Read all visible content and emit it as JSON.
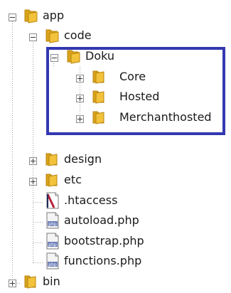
{
  "tree": {
    "nodes": [
      {
        "id": "app",
        "label": "app",
        "type": "folder",
        "state": "expanded"
      },
      {
        "id": "code",
        "label": "code",
        "type": "folder",
        "state": "expanded"
      },
      {
        "id": "doku",
        "label": "Doku",
        "type": "folder",
        "state": "expanded"
      },
      {
        "id": "core",
        "label": "Core",
        "type": "folder",
        "state": "collapsed"
      },
      {
        "id": "hosted",
        "label": "Hosted",
        "type": "folder",
        "state": "collapsed"
      },
      {
        "id": "merchanthosted",
        "label": "Merchanthosted",
        "type": "folder",
        "state": "collapsed"
      },
      {
        "id": "design",
        "label": "design",
        "type": "folder",
        "state": "collapsed"
      },
      {
        "id": "etc",
        "label": "etc",
        "type": "folder",
        "state": "collapsed"
      },
      {
        "id": "htaccess",
        "label": ".htaccess",
        "type": "file-htaccess",
        "state": "leaf"
      },
      {
        "id": "autoload",
        "label": "autoload.php",
        "type": "file-php",
        "state": "leaf"
      },
      {
        "id": "bootstrap",
        "label": "bootstrap.php",
        "type": "file-php",
        "state": "leaf"
      },
      {
        "id": "functions",
        "label": "functions.php",
        "type": "file-php",
        "state": "leaf"
      },
      {
        "id": "bin",
        "label": "bin",
        "type": "folder",
        "state": "collapsed"
      }
    ],
    "php_icon_text": "php",
    "highlight_color": "#3338b0",
    "folder_colors": {
      "front": "#f2c23a",
      "back": "#d8a21a",
      "edge": "#b88610"
    }
  }
}
